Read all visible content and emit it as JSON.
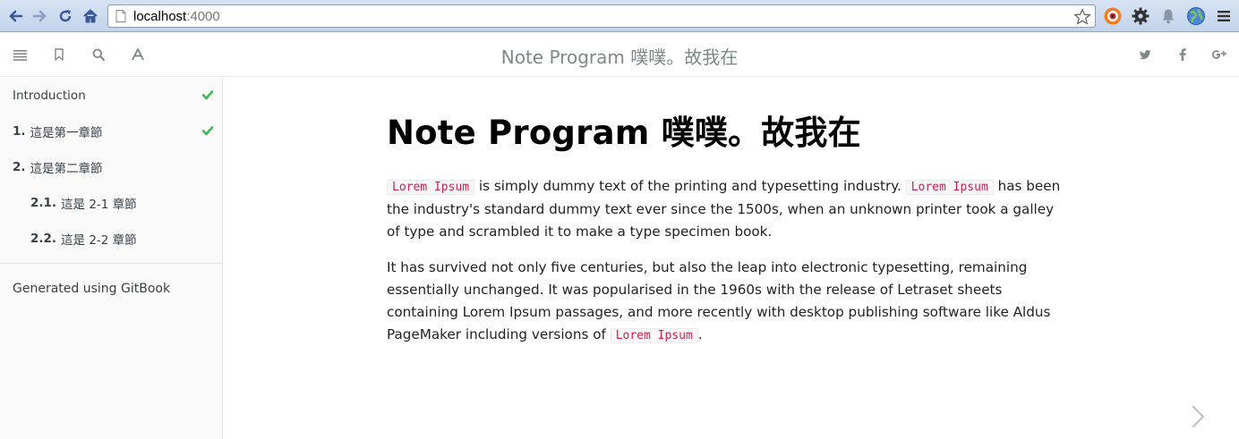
{
  "browser": {
    "url_host": "localhost",
    "url_port": ":4000"
  },
  "header": {
    "title": "Note Program 噗噗。故我在",
    "left_buttons": [
      "menu-icon",
      "bookmark-icon",
      "search-icon",
      "font-icon"
    ],
    "right_buttons": [
      "twitter-icon",
      "facebook-icon",
      "google-plus-icon"
    ]
  },
  "sidebar": {
    "items": [
      {
        "number": "",
        "label": "Introduction",
        "level": 1,
        "done": true
      },
      {
        "number": "1.",
        "label": "這是第一章節",
        "level": 1,
        "done": true
      },
      {
        "number": "2.",
        "label": "這是第二章節",
        "level": 1,
        "done": false
      },
      {
        "number": "2.1.",
        "label": "這是 2-1 章節",
        "level": 2,
        "done": false
      },
      {
        "number": "2.2.",
        "label": "這是 2-2 章節",
        "level": 2,
        "done": false
      }
    ],
    "footer": "Generated using GitBook"
  },
  "content": {
    "h1": "Note Program 噗噗。故我在",
    "p1": {
      "code1": "Lorem Ipsum",
      "text1": " is simply dummy text of the printing and typesetting industry. ",
      "code2": "Lorem Ipsum",
      "text2": " has been the industry's standard dummy text ever since the 1500s, when an unknown printer took a galley of type and scrambled it to make a type specimen book."
    },
    "p2": {
      "text1": "It has survived not only five centuries, but also the leap into electronic typesetting, remaining essentially unchanged. It was popularised in the 1960s with the release of Letraset sheets containing Lorem Ipsum passages, and more recently with desktop publishing software like Aldus PageMaker including versions of ",
      "code1": "Lorem Ipsum",
      "text2": "."
    }
  },
  "colors": {
    "check": "#3cba54",
    "code": "#c7254e",
    "header_text": "#7e888b"
  }
}
